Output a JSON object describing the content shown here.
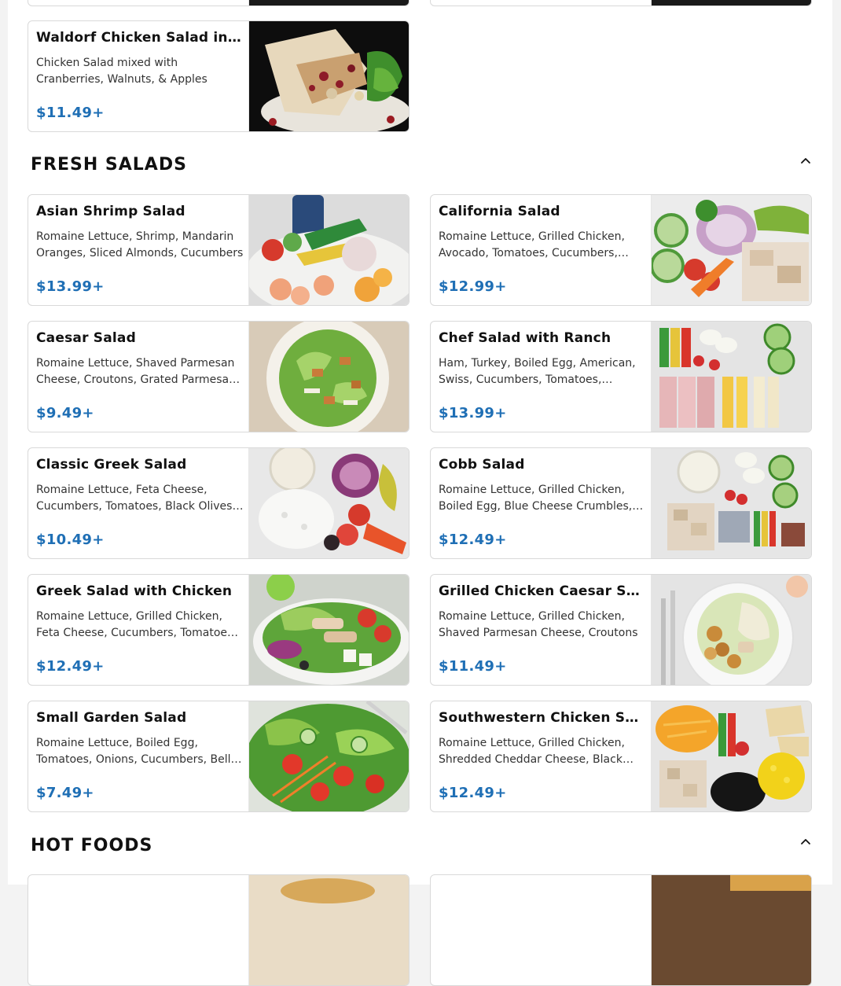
{
  "sections": {
    "fresh_salads": {
      "title": "FRESH SALADS"
    },
    "hot_foods": {
      "title": "HOT FOODS"
    }
  },
  "items": [
    {
      "name": "Waldorf Chicken Salad in Wrap",
      "desc": "Chicken Salad mixed with Cranberries, Walnuts, & Apples",
      "price": "$11.49+"
    },
    {
      "name": "Asian Shrimp Salad",
      "desc": "Romaine Lettuce, Shrimp, Mandarin Oranges, Sliced Almonds, Cucumbers",
      "price": "$13.99+"
    },
    {
      "name": "California Salad",
      "desc": "Romaine Lettuce, Grilled Chicken, Avocado, Tomatoes, Cucumbers, Carrots",
      "price": "$12.99+"
    },
    {
      "name": "Caesar Salad",
      "desc": "Romaine Lettuce, Shaved Parmesan Cheese, Croutons, Grated Parmesan Cheese",
      "price": "$9.49+"
    },
    {
      "name": "Chef Salad with Ranch",
      "desc": "Ham, Turkey, Boiled Egg, American, Swiss, Cucumbers, Tomatoes, Peppers",
      "price": "$13.99+"
    },
    {
      "name": "Classic Greek Salad",
      "desc": "Romaine Lettuce, Feta Cheese, Cucumbers, Tomatoes, Black Olives, Onions",
      "price": "$10.49+"
    },
    {
      "name": "Cobb Salad",
      "desc": "Romaine Lettuce, Grilled Chicken, Boiled Egg, Blue Cheese Crumbles, Bacon",
      "price": "$12.49+"
    },
    {
      "name": "Greek Salad with Chicken",
      "desc": "Romaine Lettuce, Grilled Chicken, Feta Cheese, Cucumbers, Tomatoes, Olives",
      "price": "$12.49+"
    },
    {
      "name": "Grilled Chicken Caesar Salad",
      "desc": "Romaine Lettuce, Grilled Chicken, Shaved Parmesan Cheese, Croutons",
      "price": "$11.49+"
    },
    {
      "name": "Small Garden Salad",
      "desc": "Romaine Lettuce, Boiled Egg, Tomatoes, Onions, Cucumbers, Bell Peppers",
      "price": "$7.49+"
    },
    {
      "name": "Southwestern Chicken Salad",
      "desc": "Romaine Lettuce, Grilled Chicken, Shredded Cheddar Cheese, Black Beans",
      "price": "$12.49+"
    }
  ],
  "colors": {
    "price": "#1f6fb5",
    "section_title": "#111111"
  },
  "icons": {
    "collapse": "chevron-up-icon"
  }
}
